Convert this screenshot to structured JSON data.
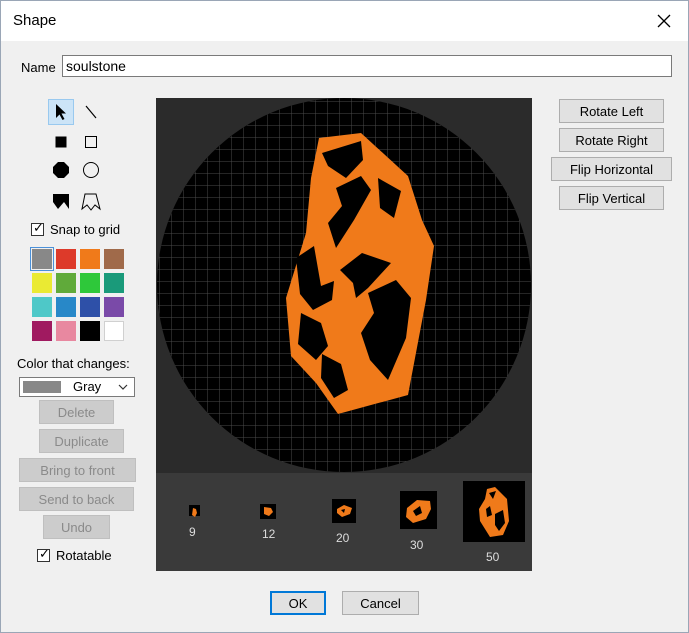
{
  "dialog": {
    "title": "Shape"
  },
  "name_field": {
    "label": "Name",
    "value": "soulstone"
  },
  "tools": [
    {
      "name": "pointer-tool",
      "icon": "arrow-pointer-icon",
      "selected": true
    },
    {
      "name": "line-tool",
      "icon": "diagonal-line-icon",
      "selected": false
    },
    {
      "name": "filled-rectangle-tool",
      "icon": "filled-square-icon",
      "selected": false
    },
    {
      "name": "rectangle-tool",
      "icon": "outline-square-icon",
      "selected": false
    },
    {
      "name": "filled-ellipse-tool",
      "icon": "filled-octagon-icon",
      "selected": false
    },
    {
      "name": "ellipse-tool",
      "icon": "outline-circle-icon",
      "selected": false
    },
    {
      "name": "filled-polygon-tool",
      "icon": "filled-polygon-icon",
      "selected": false
    },
    {
      "name": "polygon-tool",
      "icon": "outline-polygon-icon",
      "selected": false
    }
  ],
  "snap_to_grid": {
    "label": "Snap to grid",
    "checked": true
  },
  "palette": [
    "#888888",
    "#dd3a2a",
    "#f07a1a",
    "#a06a4a",
    "#eaea33",
    "#60aa3a",
    "#2ec83a",
    "#1a9a7a",
    "#4ec8c8",
    "#2888c8",
    "#2e50a8",
    "#7a4aa8",
    "#a01a60",
    "#e888a0",
    "#000000",
    "#ffffff"
  ],
  "palette_selected": "#888888",
  "color_changes": {
    "label": "Color that changes:",
    "selected_label": "Gray",
    "selected_color": "#888888"
  },
  "buttons": {
    "delete": "Delete",
    "duplicate": "Duplicate",
    "bring_to_front": "Bring to front",
    "send_to_back": "Send to back",
    "undo": "Undo",
    "rotate_left": "Rotate Left",
    "rotate_right": "Rotate Right",
    "flip_horizontal": "Flip Horizontal",
    "flip_vertical": "Flip Vertical",
    "ok": "OK",
    "cancel": "Cancel"
  },
  "rotatable": {
    "label": "Rotatable",
    "checked": true
  },
  "previews": [
    {
      "size": "9"
    },
    {
      "size": "12"
    },
    {
      "size": "20"
    },
    {
      "size": "30"
    },
    {
      "size": "50"
    }
  ],
  "shape_colors": {
    "primary": "#f07a1a",
    "secondary": "#000000",
    "canvas": "#2b2b2b"
  }
}
